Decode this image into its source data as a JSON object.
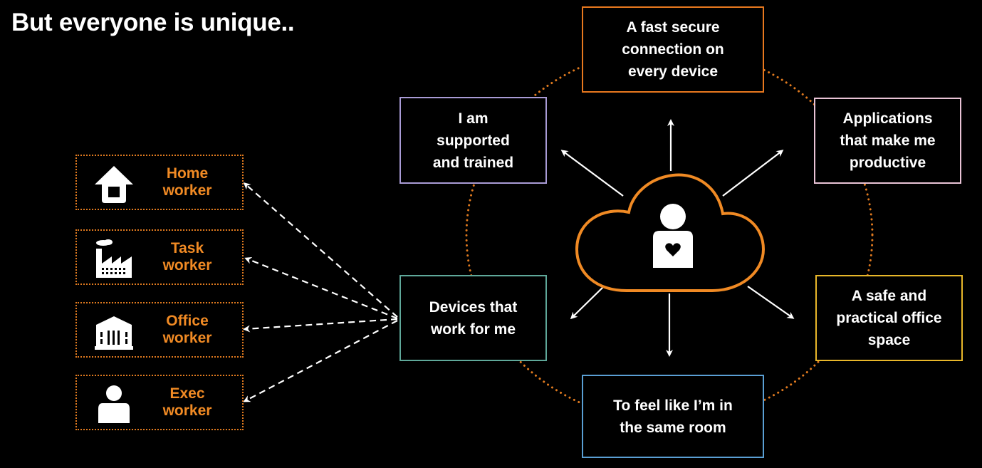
{
  "title": "But everyone is unique..",
  "workers": [
    {
      "label": "Home\nworker",
      "icon": "house-icon"
    },
    {
      "label": "Task\nworker",
      "icon": "factory-icon"
    },
    {
      "label": "Office\nworker",
      "icon": "office-building-icon"
    },
    {
      "label": "Exec\nworker",
      "icon": "person-icon"
    }
  ],
  "needs": {
    "connection": {
      "label": "A fast  secure\nconnection on\nevery device",
      "color": "#e8781e"
    },
    "applications": {
      "label": "Applications\nthat make me\nproductive",
      "color": "#e9c3d6"
    },
    "office_space": {
      "label": "A safe and\npractical office\nspace",
      "color": "#e8b72a"
    },
    "same_room": {
      "label": "To feel like I’m in\nthe same room",
      "color": "#5a9fd4"
    },
    "devices": {
      "label": "Devices that\nwork for me",
      "color": "#5fa89a"
    },
    "supported": {
      "label": "I am\nsupported\nand trained",
      "color": "#a99bd6"
    }
  },
  "center": {
    "icon": "cloud-user-heart-icon",
    "color": "#f08a24"
  },
  "colors": {
    "accent": "#f08a24",
    "ring": "#e07a1f",
    "background": "#000000"
  }
}
